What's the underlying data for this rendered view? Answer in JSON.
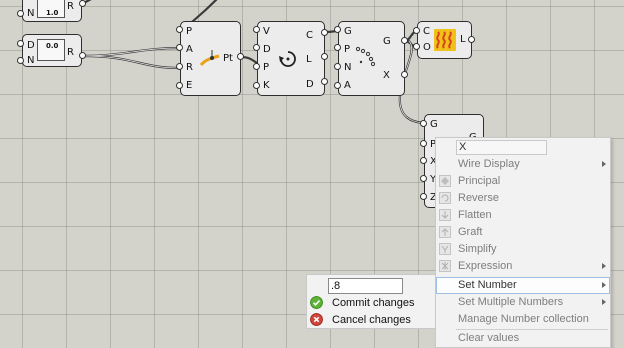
{
  "canvas": {
    "slider1": {
      "value": "1.0",
      "inputs": [
        "N"
      ],
      "output": "R"
    },
    "slider2": {
      "value": "0.0",
      "inputs": [
        "D",
        "N"
      ],
      "output": "R"
    },
    "eval_curve": {
      "inputs": [
        "P",
        "A",
        "R",
        "E"
      ],
      "output": "Pt"
    },
    "rotate": {
      "inputs": [
        "V",
        "D",
        "P",
        "K"
      ],
      "outputs": [
        "C",
        "L",
        "D"
      ]
    },
    "points": {
      "inputs": [
        "G",
        "P",
        "N",
        "A"
      ],
      "outputs": [
        "G",
        "X"
      ]
    },
    "heat": {
      "inputs": [
        "C",
        "O"
      ],
      "output": "L"
    },
    "selected": {
      "inputs": [
        "G",
        "P",
        "X",
        "Y",
        "Z"
      ],
      "output": "G"
    }
  },
  "context_menu": {
    "title": "X",
    "items": [
      {
        "label": "Wire Display",
        "icon": "none",
        "submenu": true
      },
      {
        "label": "Principal",
        "icon": "principal-icon",
        "submenu": false
      },
      {
        "label": "Reverse",
        "icon": "reverse-icon",
        "submenu": false
      },
      {
        "label": "Flatten",
        "icon": "flatten-icon",
        "submenu": false
      },
      {
        "label": "Graft",
        "icon": "graft-icon",
        "submenu": false
      },
      {
        "label": "Simplify",
        "icon": "simplify-icon",
        "submenu": false
      },
      {
        "label": "Expression",
        "icon": "expression-icon",
        "submenu": true
      },
      {
        "label": "Set Number",
        "icon": "none",
        "submenu": true
      },
      {
        "label": "Set Multiple Numbers",
        "icon": "none",
        "submenu": true
      },
      {
        "label": "Manage Number collection",
        "icon": "none",
        "submenu": false
      },
      {
        "label": "Clear values",
        "icon": "none",
        "submenu": false
      }
    ]
  },
  "set_number_submenu": {
    "input_value": ".8",
    "commit_label": "Commit changes",
    "cancel_label": "Cancel changes"
  },
  "colors": {
    "canvas": "#d4d3cb",
    "commit": "#5cb335",
    "cancel": "#d0463a",
    "highlight": "#9fbfe2"
  }
}
